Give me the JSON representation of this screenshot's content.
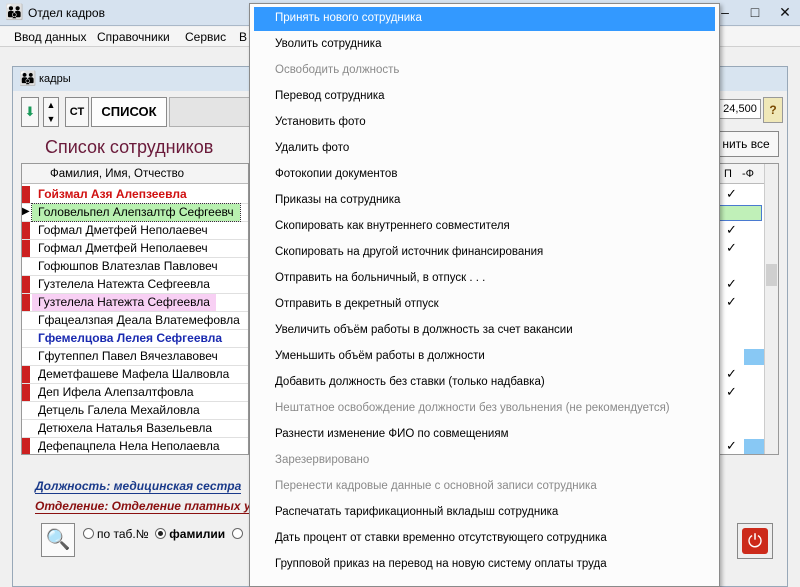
{
  "window": {
    "title": "Отдел кадров"
  },
  "menubar": [
    "Ввод данных",
    "Справочники",
    "Сервис",
    "В"
  ],
  "inner": {
    "title": "кадры",
    "toolbar": {
      "st_label": "СТ",
      "tab_label": "СПИСОК"
    },
    "list_title": "Список сотрудников",
    "grid_header": "Фамилия, Имя, Отчество",
    "rows": [
      {
        "name": "Гойзмал Азя Алепзеевла",
        "marker": "#cc2020",
        "color": "#d01010",
        "bold": true,
        "bg": ""
      },
      {
        "name": "Головельпел Алепзалтф Сефгеевч",
        "marker": "",
        "color": "#000000",
        "bold": false,
        "bg": "#b8f0b0",
        "current": true
      },
      {
        "name": "Гофмал Дметфей Неполаевеч",
        "marker": "#cc2020",
        "color": "#000000",
        "bold": false,
        "bg": ""
      },
      {
        "name": "Гофмал Дметфей Неполаевеч",
        "marker": "#cc2020",
        "color": "#000000",
        "bold": false,
        "bg": ""
      },
      {
        "name": "Гофюшпов Влатезлав Павловеч",
        "marker": "",
        "color": "#000000",
        "bold": false,
        "bg": ""
      },
      {
        "name": "Гузтелела Натежта Сефгеевла",
        "marker": "#cc2020",
        "color": "#000000",
        "bold": false,
        "bg": ""
      },
      {
        "name": "Гузтелела Натежта Сефгеевла",
        "marker": "#cc2020",
        "color": "#000000",
        "bold": false,
        "bg": "#f8d0f4"
      },
      {
        "name": "Гфацеалзпая Деала Влатемефовла",
        "marker": "",
        "color": "#000000",
        "bold": false,
        "bg": ""
      },
      {
        "name": "Гфемелцова Лелея Сефгеевла",
        "marker": "",
        "color": "#1a2ab0",
        "bold": true,
        "bg": ""
      },
      {
        "name": "Гфутеппел Павел Вячезлавовеч",
        "marker": "",
        "color": "#000000",
        "bold": false,
        "bg": ""
      },
      {
        "name": "Деметфашеве Мафела Шалвовла",
        "marker": "#cc2020",
        "color": "#000000",
        "bold": false,
        "bg": ""
      },
      {
        "name": "Деп Ифела Алепзалтфовла",
        "marker": "#cc2020",
        "color": "#000000",
        "bold": false,
        "bg": ""
      },
      {
        "name": "Детцель Галела Мехайловла",
        "marker": "",
        "color": "#000000",
        "bold": false,
        "bg": ""
      },
      {
        "name": "Детюхела Наталья Вазельевла",
        "marker": "",
        "color": "#000000",
        "bold": false,
        "bg": ""
      },
      {
        "name": "Дефепацпела Нела Неполаевла",
        "marker": "#cc2020",
        "color": "#000000",
        "bold": false,
        "bg": ""
      }
    ],
    "position_text": "Должность: медицинская сестра",
    "department_text": "Отделение: Отделение платных услуг",
    "radio": {
      "opt1": "по таб.№",
      "opt2": "фамилии"
    },
    "amount": "24,500",
    "clear_all_label": "нить все",
    "right_header": {
      "p": "П",
      "f": "-Ф"
    },
    "checks": [
      {
        "row": 0,
        "text": "✓"
      },
      {
        "row": 2,
        "text": "✓"
      },
      {
        "row": 3,
        "text": "✓"
      },
      {
        "row": 5,
        "text": "✓"
      },
      {
        "row": 6,
        "text": "✓"
      },
      {
        "row": 10,
        "text": "✓"
      },
      {
        "row": 11,
        "text": "✓"
      },
      {
        "row": 14,
        "text": "✓"
      }
    ]
  },
  "context_menu": [
    {
      "label": "Принять нового сотрудника",
      "state": "highlighted"
    },
    {
      "label": "Уволить сотрудника",
      "state": "enabled"
    },
    {
      "label": "Освободить должность",
      "state": "disabled"
    },
    {
      "label": "Перевод сотрудника",
      "state": "enabled"
    },
    {
      "label": "Установить фото",
      "state": "enabled"
    },
    {
      "label": "Удалить фото",
      "state": "enabled"
    },
    {
      "label": "Фотокопии документов",
      "state": "enabled"
    },
    {
      "label": "Приказы на сотрудника",
      "state": "enabled"
    },
    {
      "label": "Скопировать как внутреннего совместителя",
      "state": "enabled"
    },
    {
      "label": "Скопировать на другой источник финансирования",
      "state": "enabled"
    },
    {
      "label": "Отправить на больничный, в отпуск . . .",
      "state": "enabled"
    },
    {
      "label": "Отправить в декретный отпуск",
      "state": "enabled"
    },
    {
      "label": "Увеличить объём работы в должность за счет вакансии",
      "state": "enabled"
    },
    {
      "label": "Уменьшить объём работы в должности",
      "state": "enabled"
    },
    {
      "label": "Добавить должность без ставки (только надбавка)",
      "state": "enabled"
    },
    {
      "label": "Нештатное освобождение должности без увольнения (не рекомендуется)",
      "state": "disabled"
    },
    {
      "label": "Разнести изменение ФИО по совмещениям",
      "state": "enabled"
    },
    {
      "label": "Зарезервировано",
      "state": "disabled"
    },
    {
      "label": "Перенести кадровые данные с основной записи сотрудника",
      "state": "disabled"
    },
    {
      "label": "Распечатать тарификационный вкладыш сотрудника",
      "state": "enabled"
    },
    {
      "label": "Дать процент от ставки временно отсутствующего сотрудника",
      "state": "enabled"
    },
    {
      "label": "Групповой приказ на перевод на новую систему оплаты труда",
      "state": "enabled"
    }
  ],
  "colors": {
    "highlight": "#3399ff",
    "title_purple": "#6a1a3a"
  }
}
